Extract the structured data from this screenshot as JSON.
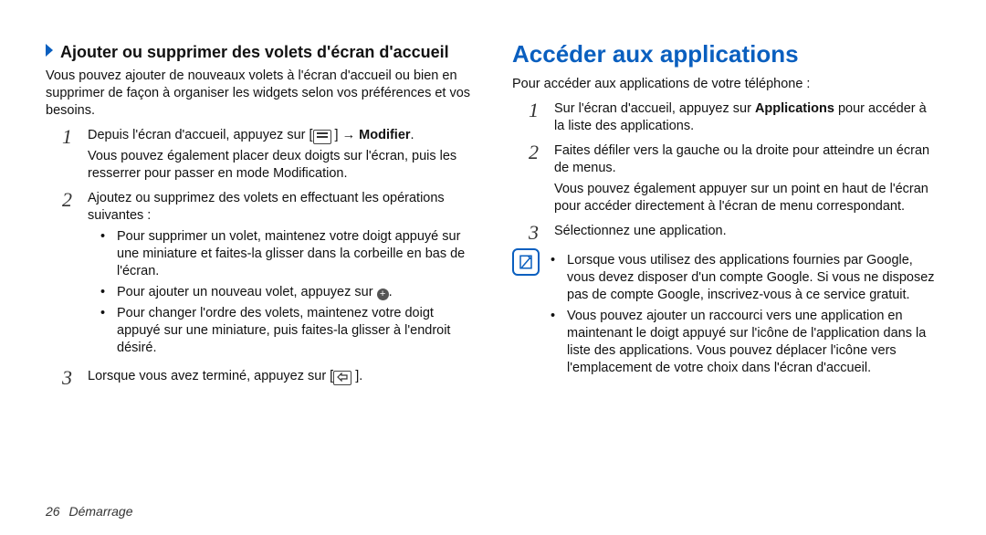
{
  "left": {
    "heading": "Ajouter ou supprimer des volets d'écran d'accueil",
    "intro": "Vous pouvez ajouter de nouveaux volets à l'écran d'accueil ou bien en supprimer de façon à organiser les widgets selon vos préférences et vos besoins.",
    "step1_pre": "Depuis l'écran d'accueil, appuyez sur [",
    "step1_arrow": " ] → ",
    "step1_bold": "Modifier",
    "step1_post": ".",
    "step1_extra": "Vous pouvez également placer deux doigts sur l'écran, puis les resserrer pour passer en mode Modification.",
    "step2": "Ajoutez ou supprimez des volets en effectuant les opérations suivantes :",
    "bullet1": "Pour supprimer un volet, maintenez votre doigt appuyé sur une miniature et faites-la glisser dans la corbeille en bas de l'écran.",
    "bullet2_pre": "Pour ajouter un nouveau volet, appuyez sur ",
    "bullet2_post": ".",
    "bullet3": "Pour changer l'ordre des volets, maintenez votre doigt appuyé sur une miniature, puis faites-la glisser à l'endroit désiré.",
    "step3_pre": "Lorsque vous avez terminé, appuyez sur [",
    "step3_post": " ]."
  },
  "right": {
    "heading": "Accéder aux applications",
    "intro": "Pour accéder aux applications de votre téléphone :",
    "step1_pre": "Sur l'écran d'accueil, appuyez sur ",
    "step1_bold": "Applications",
    "step1_post": " pour accéder à la liste des applications.",
    "step2": "Faites défiler vers la gauche ou la droite pour atteindre un écran de menus.",
    "step2_extra": "Vous pouvez également appuyer sur un point en haut de l'écran pour accéder directement à l'écran de menu correspondant.",
    "step3": "Sélectionnez une application.",
    "note1": "Lorsque vous utilisez des applications fournies par Google, vous devez disposer d'un compte Google. Si vous ne disposez pas de compte Google, inscrivez-vous à ce service gratuit.",
    "note2": "Vous pouvez ajouter un raccourci vers une application en maintenant le doigt appuyé sur l'icône de l'application dans la liste des applications. Vous pouvez déplacer l'icône vers l'emplacement de votre choix dans l'écran d'accueil."
  },
  "footer": {
    "page": "26",
    "section": "Démarrage"
  },
  "icons": {
    "menu": "menu-icon",
    "back": "back-icon",
    "plus": "+",
    "note": "note-icon"
  }
}
